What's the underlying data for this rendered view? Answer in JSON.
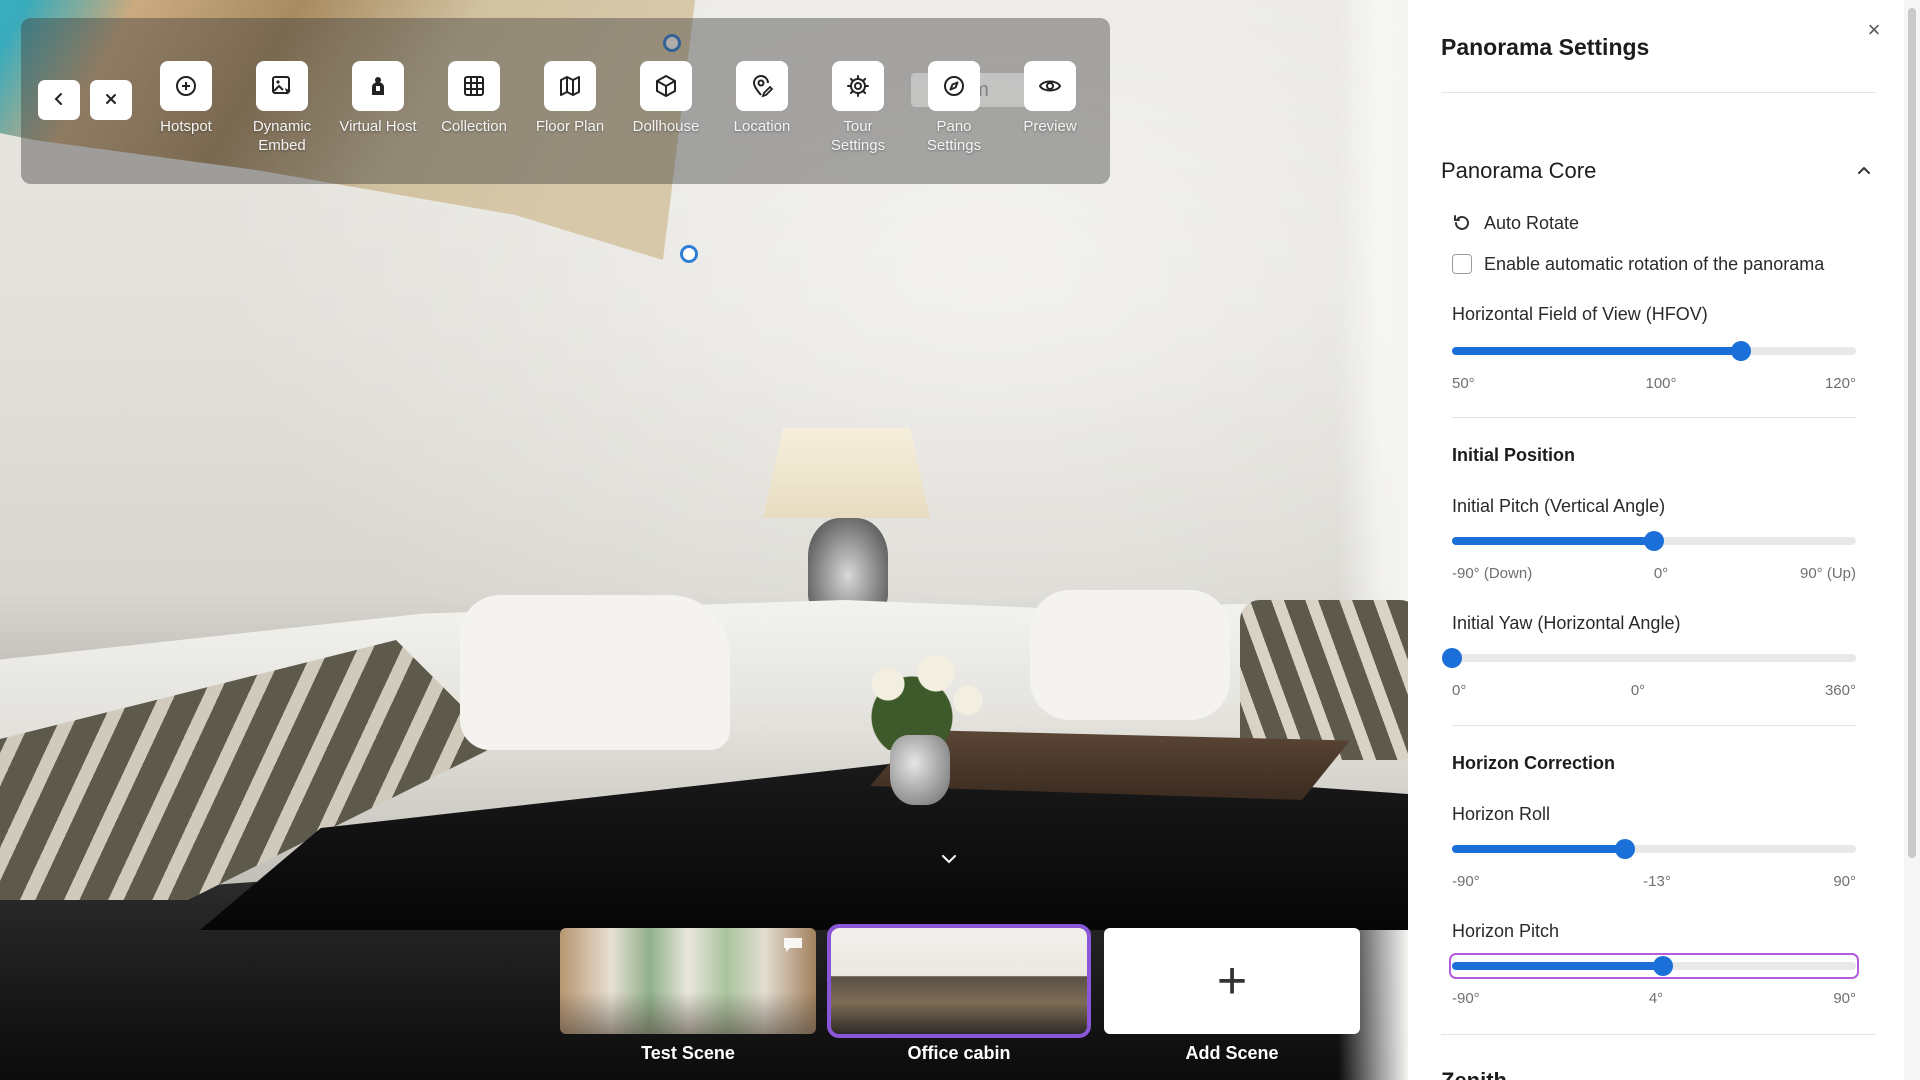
{
  "toolbar": {
    "back_label": "‹",
    "close_label": "✕",
    "ghost_label": "Be   om",
    "tools": [
      {
        "label": "Hotspot",
        "icon": "hotspot-icon"
      },
      {
        "label": "Dynamic Embed",
        "icon": "dynamic-embed-icon"
      },
      {
        "label": "Virtual Host",
        "icon": "virtual-host-icon"
      },
      {
        "label": "Collection",
        "icon": "collection-icon"
      },
      {
        "label": "Floor Plan",
        "icon": "floor-plan-icon"
      },
      {
        "label": "Dollhouse",
        "icon": "dollhouse-icon"
      },
      {
        "label": "Location",
        "icon": "location-icon"
      },
      {
        "label": "Tour Settings",
        "icon": "tour-settings-icon"
      },
      {
        "label": "Pano Settings",
        "icon": "pano-settings-icon"
      },
      {
        "label": "Preview",
        "icon": "preview-icon"
      }
    ]
  },
  "scenes": [
    {
      "label": "Test Scene",
      "active": false
    },
    {
      "label": "Office cabin",
      "active": true
    },
    {
      "label": "Add Scene",
      "add": true,
      "icon": "plus-icon"
    }
  ],
  "panel": {
    "title": "Panorama Settings",
    "close_label": "×",
    "section_title": "Panorama Core",
    "auto_rotate": {
      "label": "Auto Rotate",
      "checkbox_label": "Enable automatic rotation of the panorama",
      "checked": false
    },
    "hfov": {
      "label": "Horizontal Field of View (HFOV)",
      "min_label": "50°",
      "mid_label": "100°",
      "max_label": "120°",
      "min": 50,
      "max": 120,
      "value": 100
    },
    "initial_position": {
      "heading": "Initial Position",
      "pitch": {
        "label": "Initial Pitch (Vertical Angle)",
        "min_label": "-90° (Down)",
        "mid_label": "0°",
        "max_label": "90° (Up)",
        "min": -90,
        "max": 90,
        "value": 0
      },
      "yaw": {
        "label": "Initial Yaw (Horizontal Angle)",
        "min_label": "0°",
        "mid_label": "0°",
        "max_label": "360°",
        "min": 0,
        "max": 360,
        "value": 0
      }
    },
    "horizon_correction": {
      "heading": "Horizon Correction",
      "roll": {
        "label": "Horizon Roll",
        "min_label": "-90°",
        "mid_label": "-13°",
        "max_label": "90°",
        "min": -90,
        "max": 90,
        "value": -13
      },
      "pitch": {
        "label": "Horizon Pitch",
        "min_label": "-90°",
        "mid_label": "4°",
        "max_label": "90°",
        "min": -90,
        "max": 90,
        "value": 4
      }
    },
    "next_section_partial": "Zenith"
  },
  "colors": {
    "accent": "#1b6fd8",
    "focus": "#b35cdc",
    "active_scene": "#8a57d8"
  }
}
